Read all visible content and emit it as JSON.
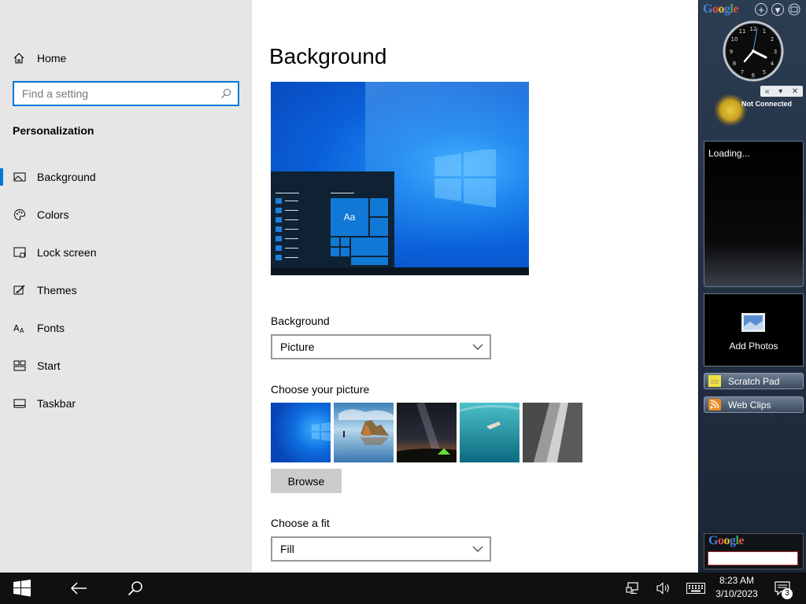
{
  "settings": {
    "nav_home": "Home",
    "search_placeholder": "Find a setting",
    "section_title": "Personalization",
    "nav_items": [
      {
        "label": "Background",
        "icon": "picture-icon",
        "active": true
      },
      {
        "label": "Colors",
        "icon": "palette-icon",
        "active": false
      },
      {
        "label": "Lock screen",
        "icon": "lock-screen-icon",
        "active": false
      },
      {
        "label": "Themes",
        "icon": "themes-icon",
        "active": false
      },
      {
        "label": "Fonts",
        "icon": "fonts-icon",
        "active": false
      },
      {
        "label": "Start",
        "icon": "start-icon",
        "active": false
      },
      {
        "label": "Taskbar",
        "icon": "taskbar-icon",
        "active": false
      }
    ]
  },
  "main": {
    "title": "Background",
    "preview": {
      "tile_text": "Aa"
    },
    "background_label": "Background",
    "background_value": "Picture",
    "choose_picture_label": "Choose your picture",
    "pictures": [
      {
        "name": "windows-blue-thumb"
      },
      {
        "name": "beach-rocks-thumb"
      },
      {
        "name": "night-sky-tent-thumb"
      },
      {
        "name": "underwater-swimmer-thumb"
      },
      {
        "name": "rock-cliff-thumb"
      }
    ],
    "browse_label": "Browse",
    "fit_label": "Choose a fit",
    "fit_value": "Fill"
  },
  "google_sidebar": {
    "logo": [
      "G",
      "o",
      "o",
      "g",
      "l",
      "e"
    ],
    "add_button": "+",
    "menu_button": "▾",
    "gadget_controls": [
      "«",
      "▾",
      "✕"
    ],
    "weather_status": "Not Connected",
    "news_status": "Loading...",
    "photos_label": "Add Photos",
    "tabs": [
      "Scratch Pad",
      "Web Clips"
    ]
  },
  "taskbar": {
    "time": "8:23 AM",
    "date": "3/10/2023",
    "notification_count": "3"
  },
  "colors": {
    "accent": "#0078d7",
    "sidebar_bg": "#e6e6e6",
    "taskbar_bg": "#101010"
  }
}
